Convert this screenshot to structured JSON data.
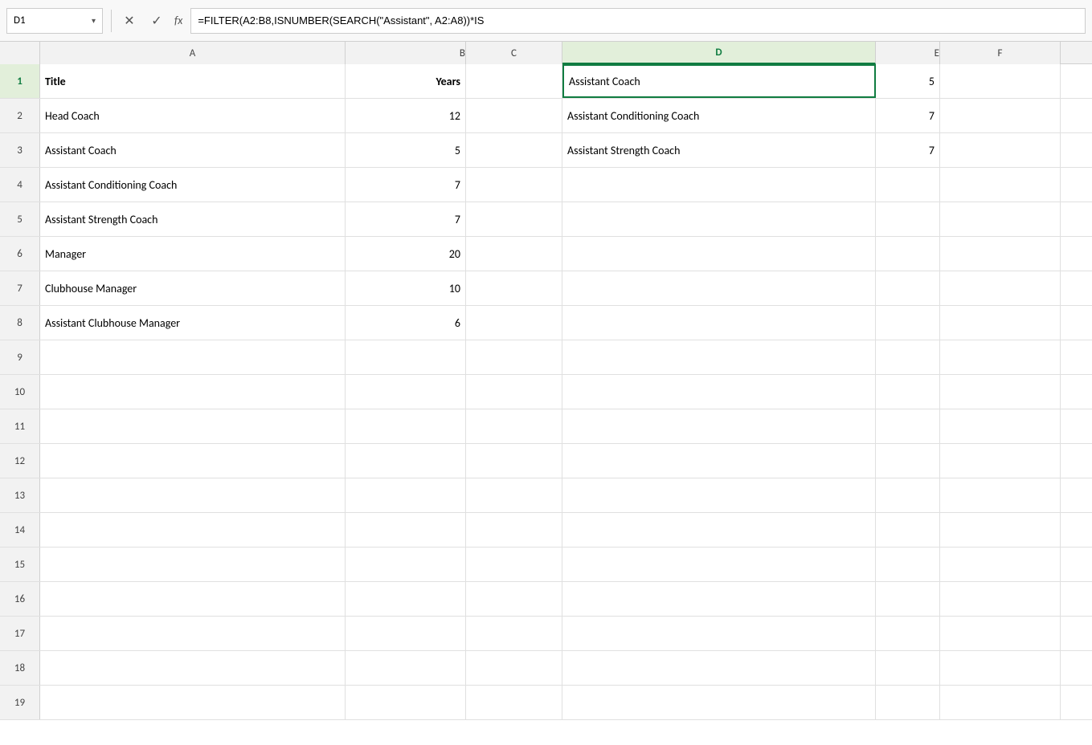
{
  "formulaBar": {
    "cellRef": "D1",
    "dropdownArrow": "▾",
    "cancelIcon": "✕",
    "confirmIcon": "✓",
    "fxLabel": "fx",
    "formula": "=FILTER(A2:B8,ISNUMBER(SEARCH(\"Assistant\", A2:A8))*IS"
  },
  "columns": {
    "rowHeader": "",
    "A": "A",
    "B": "B",
    "C": "C",
    "D": "D",
    "E": "E",
    "F": "F"
  },
  "rows": [
    {
      "rowNum": "1",
      "A": "Title",
      "B": "Years",
      "C": "",
      "D": "Assistant Coach",
      "E": "5",
      "F": ""
    },
    {
      "rowNum": "2",
      "A": "Head Coach",
      "B": "12",
      "C": "",
      "D": "Assistant Conditioning Coach",
      "E": "7",
      "F": ""
    },
    {
      "rowNum": "3",
      "A": "Assistant Coach",
      "B": "5",
      "C": "",
      "D": "Assistant Strength Coach",
      "E": "7",
      "F": ""
    },
    {
      "rowNum": "4",
      "A": "Assistant Conditioning Coach",
      "B": "7",
      "C": "",
      "D": "",
      "E": "",
      "F": ""
    },
    {
      "rowNum": "5",
      "A": "Assistant Strength Coach",
      "B": "7",
      "C": "",
      "D": "",
      "E": "",
      "F": ""
    },
    {
      "rowNum": "6",
      "A": "Manager",
      "B": "20",
      "C": "",
      "D": "",
      "E": "",
      "F": ""
    },
    {
      "rowNum": "7",
      "A": "Clubhouse Manager",
      "B": "10",
      "C": "",
      "D": "",
      "E": "",
      "F": ""
    },
    {
      "rowNum": "8",
      "A": "Assistant Clubhouse Manager",
      "B": "6",
      "C": "",
      "D": "",
      "E": "",
      "F": ""
    },
    {
      "rowNum": "9",
      "A": "",
      "B": "",
      "C": "",
      "D": "",
      "E": "",
      "F": ""
    },
    {
      "rowNum": "10",
      "A": "",
      "B": "",
      "C": "",
      "D": "",
      "E": "",
      "F": ""
    },
    {
      "rowNum": "11",
      "A": "",
      "B": "",
      "C": "",
      "D": "",
      "E": "",
      "F": ""
    },
    {
      "rowNum": "12",
      "A": "",
      "B": "",
      "C": "",
      "D": "",
      "E": "",
      "F": ""
    },
    {
      "rowNum": "13",
      "A": "",
      "B": "",
      "C": "",
      "D": "",
      "E": "",
      "F": ""
    },
    {
      "rowNum": "14",
      "A": "",
      "B": "",
      "C": "",
      "D": "",
      "E": "",
      "F": ""
    },
    {
      "rowNum": "15",
      "A": "",
      "B": "",
      "C": "",
      "D": "",
      "E": "",
      "F": ""
    },
    {
      "rowNum": "16",
      "A": "",
      "B": "",
      "C": "",
      "D": "",
      "E": "",
      "F": ""
    },
    {
      "rowNum": "17",
      "A": "",
      "B": "",
      "C": "",
      "D": "",
      "E": "",
      "F": ""
    },
    {
      "rowNum": "18",
      "A": "",
      "B": "",
      "C": "",
      "D": "",
      "E": "",
      "F": ""
    },
    {
      "rowNum": "19",
      "A": "",
      "B": "",
      "C": "",
      "D": "",
      "E": "",
      "F": ""
    }
  ]
}
